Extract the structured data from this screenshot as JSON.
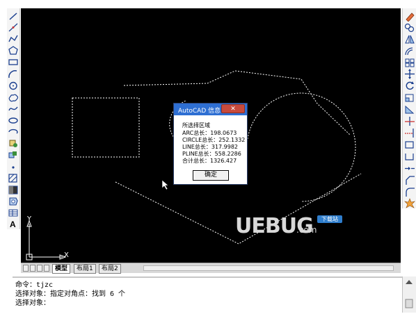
{
  "layout_tabs": {
    "tabs": [
      {
        "label": "模型",
        "active": true
      },
      {
        "label": "布局1",
        "active": false
      },
      {
        "label": "布局2",
        "active": false
      }
    ]
  },
  "dialog": {
    "title": "AutoCAD 信息",
    "close_glyph": "✕",
    "heading": "所选择区域",
    "lines": [
      "ARC总长：198.0673",
      "CIRCLE总长：252.1332",
      "LINE总长：317.9982",
      "PLINE总长：558.2286",
      "合计总长：1326.427"
    ],
    "ok_label": "确定"
  },
  "command": {
    "lines": [
      "命令：tjzc",
      "选择对象：指定对角点：找到 6 个",
      "选择对象："
    ]
  },
  "ucs": {
    "x_label": "X",
    "y_label": "Y"
  },
  "watermark": {
    "main": "UEBUG",
    "sub": ".com",
    "badge": "下载站"
  },
  "toolbars": {
    "left": [
      "line-icon",
      "construction-line-icon",
      "polyline-icon",
      "polygon-icon",
      "rectangle-icon",
      "arc-icon",
      "circle-icon",
      "revision-cloud-icon",
      "spline-icon",
      "ellipse-icon",
      "ellipse-arc-icon",
      "insert-block-icon",
      "make-block-icon",
      "point-icon",
      "hatch-icon",
      "gradient-icon",
      "region-icon",
      "table-icon",
      "multiline-text-icon"
    ],
    "right": [
      "erase-icon",
      "copy-icon",
      "mirror-icon",
      "offset-icon",
      "array-icon",
      "move-icon",
      "rotate-icon",
      "scale-icon",
      "stretch-icon",
      "trim-icon",
      "extend-icon",
      "break-at-point-icon",
      "break-icon",
      "join-icon",
      "chamfer-icon",
      "fillet-icon",
      "explode-icon"
    ]
  }
}
